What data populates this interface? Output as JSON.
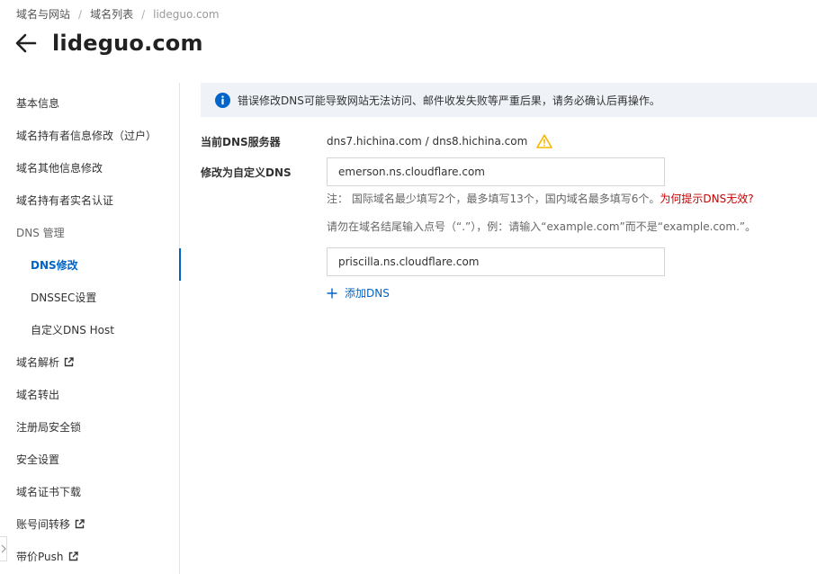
{
  "breadcrumb": {
    "items": [
      "域名与网站",
      "域名列表",
      "lideguo.com"
    ],
    "separator": "/"
  },
  "header": {
    "title": "lideguo.com"
  },
  "sidebar": {
    "items": [
      {
        "label": "基本信息"
      },
      {
        "label": "域名持有者信息修改（过户）"
      },
      {
        "label": "域名其他信息修改"
      },
      {
        "label": "域名持有者实名认证"
      },
      {
        "label": "DNS 管理"
      },
      {
        "label": "DNS修改"
      },
      {
        "label": "DNSSEC设置"
      },
      {
        "label": "自定义DNS Host"
      },
      {
        "label": "域名解析",
        "icon": "external-link-icon"
      },
      {
        "label": "域名转出"
      },
      {
        "label": "注册局安全锁"
      },
      {
        "label": "安全设置"
      },
      {
        "label": "域名证书下载"
      },
      {
        "label": "账号间转移",
        "icon": "external-link-icon"
      },
      {
        "label": "带价Push",
        "icon": "external-link-icon"
      }
    ],
    "active_label": "DNS修改"
  },
  "alert": {
    "icon": "info-icon",
    "text": "错误修改DNS可能导致网站无法访问、邮件收发失败等严重后果，请务必确认后再操作。"
  },
  "form": {
    "current_label": "当前DNS服务器",
    "current_value": "dns7.hichina.com / dns8.hichina.com",
    "warning_icon": "warning-icon",
    "custom_label": "修改为自定义DNS",
    "dns1_value": "emerson.ns.cloudflare.com",
    "dns2_value": "priscilla.ns.cloudflare.com",
    "note_text": "注：  国际域名最少填写2个，最多填写13个，国内域名最多填写6个。",
    "note_link": "为何提示DNS无效?",
    "hint_text": "请勿在域名结尾输入点号（“.”），例：请输入“example.com”而不是“example.com.”。",
    "add_label": "添加DNS"
  },
  "colors": {
    "accent": "#0064c8",
    "warning": "#f5b800",
    "alert_link": "#c80000",
    "alert_bg": "#eff3f8"
  }
}
